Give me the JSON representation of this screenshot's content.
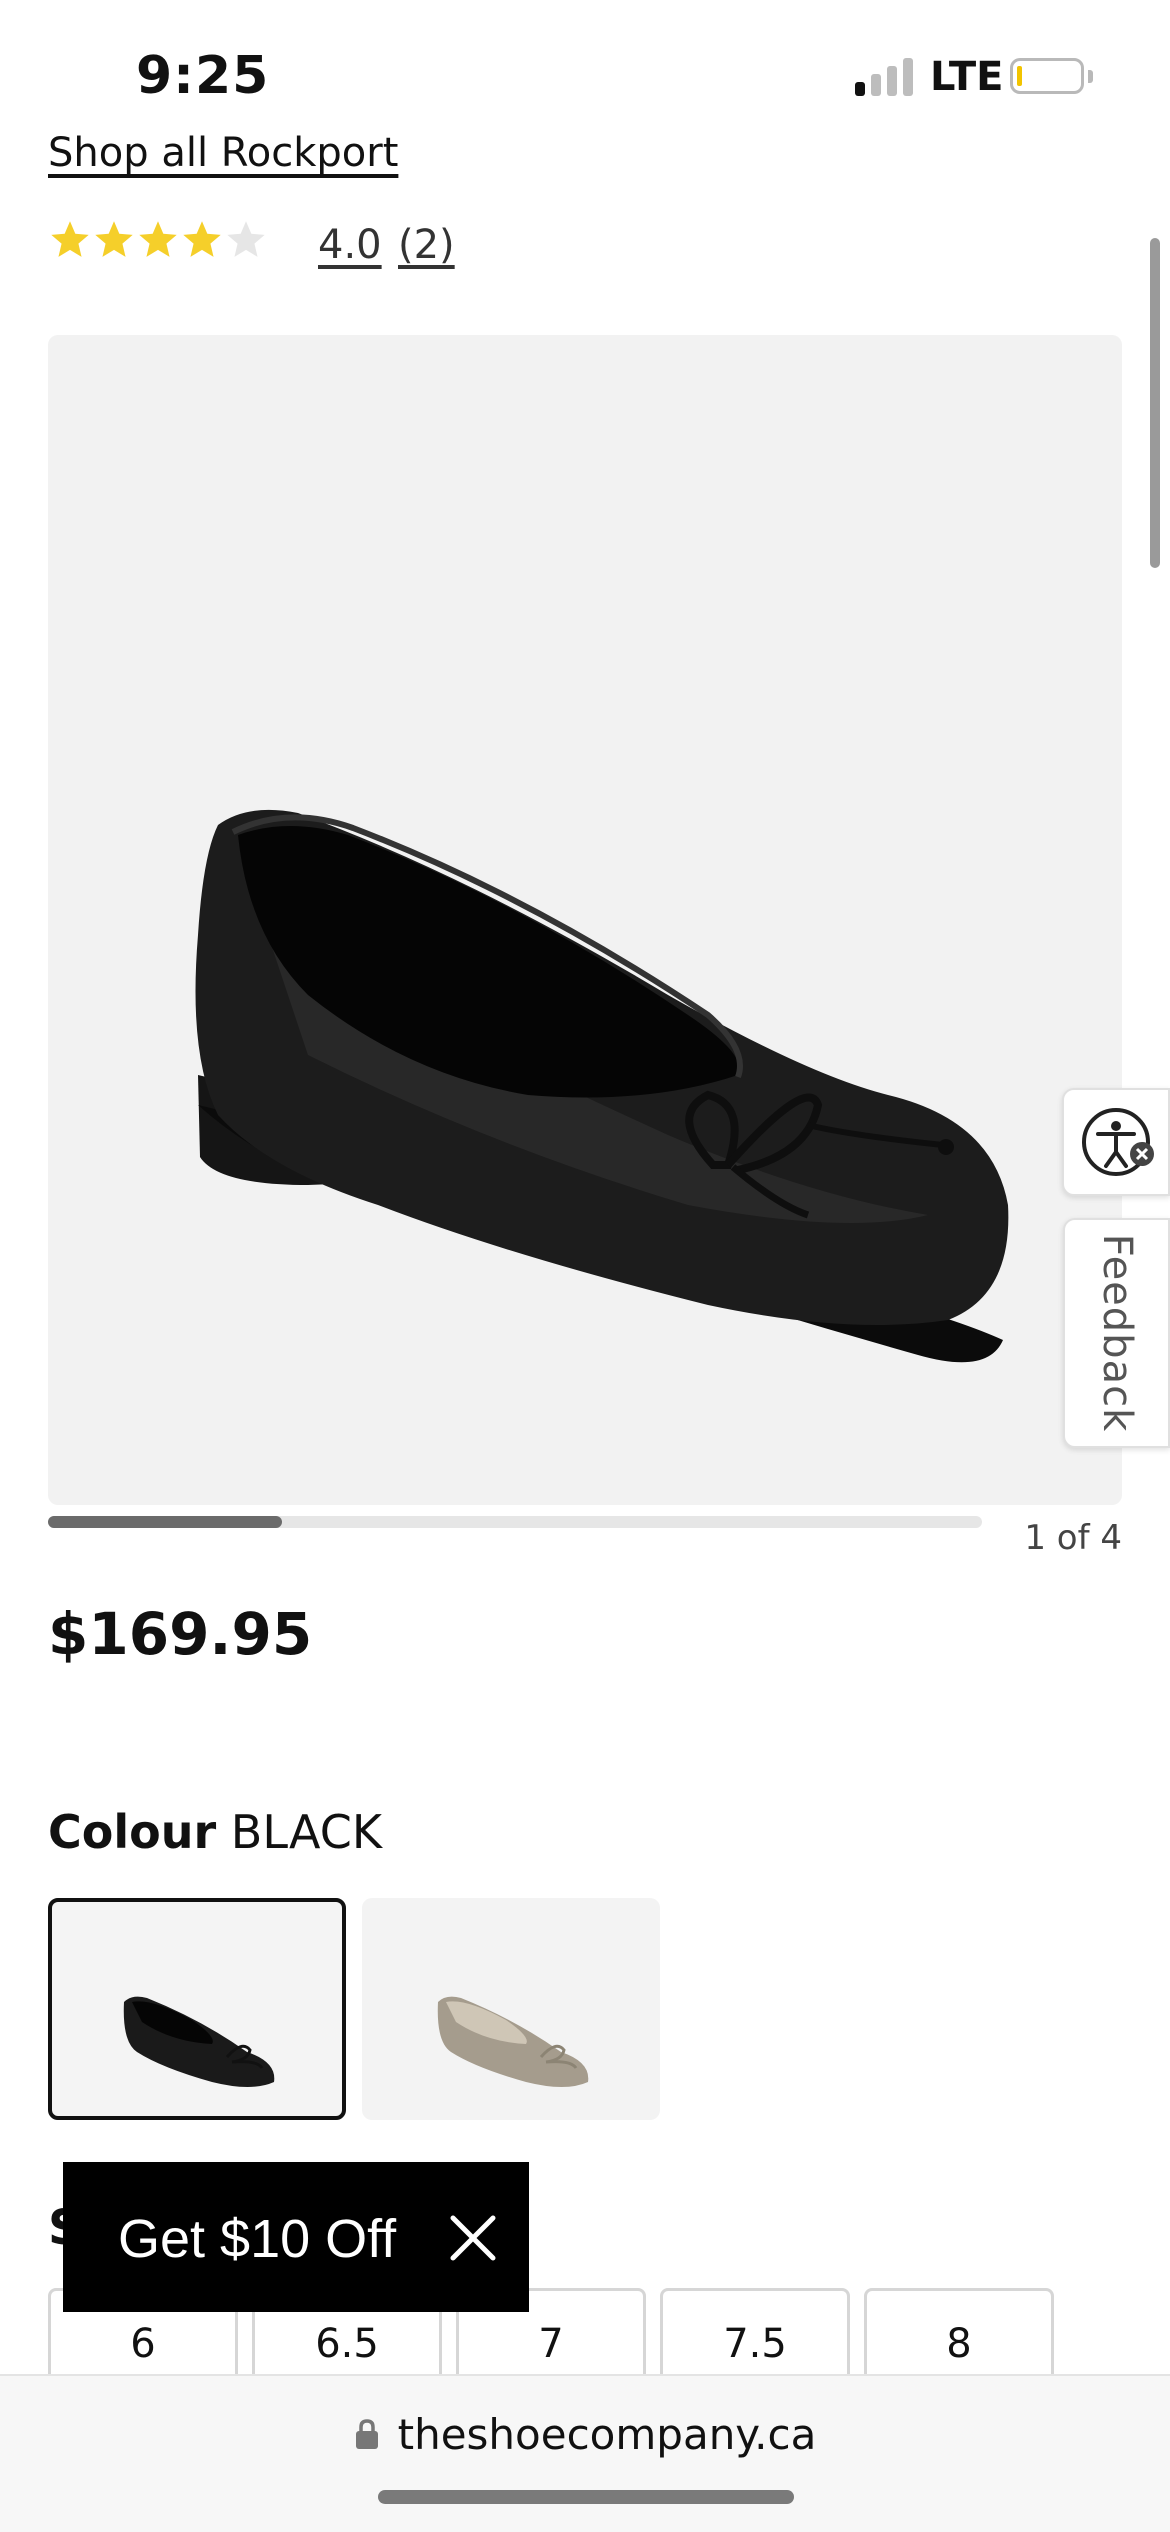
{
  "status_bar": {
    "time": "9:25",
    "network": "LTE",
    "battery_level": 0.08
  },
  "product": {
    "shop_link": "Shop all Rockport",
    "rating": {
      "stars": 4,
      "max_stars": 5,
      "value": "4.0",
      "count": "(2)"
    },
    "image": {
      "icon": "black-ballet-flat-image",
      "current": 1,
      "total": 4,
      "counter": "1 of 4"
    },
    "price": "$169.95"
  },
  "colour": {
    "label": "Colour",
    "selected": "BLACK",
    "swatches": [
      {
        "name": "black-flat-swatch",
        "selected": true
      },
      {
        "name": "metallic-flat-swatch",
        "selected": false
      }
    ]
  },
  "size": {
    "heading": "S",
    "options": [
      "6",
      "6.5",
      "7",
      "7.5",
      "8"
    ]
  },
  "promo": {
    "text": "Get $10 Off",
    "close_icon": "close-icon"
  },
  "side_widgets": {
    "accessibility_icon": "accessibility-icon",
    "feedback_label": "Feedback"
  },
  "browser": {
    "url": "theshoecompany.ca",
    "lock_icon": "lock-icon"
  },
  "colors": {
    "star": "#f5cf2a",
    "star_empty": "#e6e6e6",
    "promo_bg": "#000000"
  }
}
